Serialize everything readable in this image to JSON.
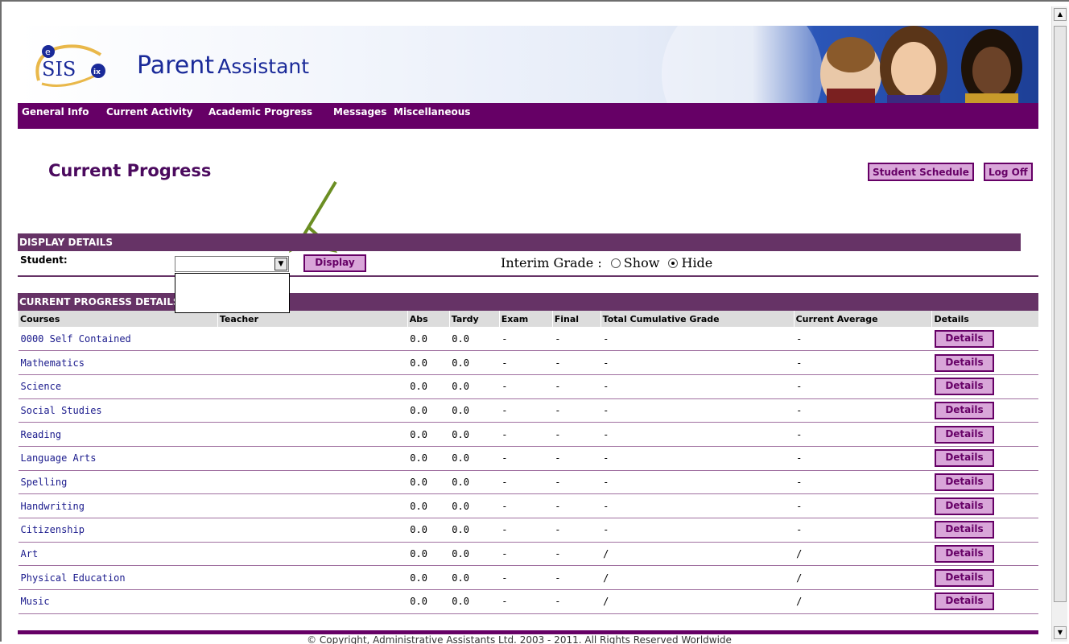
{
  "brand": {
    "logo_text": "SIS",
    "title_main": "Parent",
    "title_sub": "Assistant"
  },
  "nav": {
    "items": [
      "General Info",
      "Current Activity",
      "Academic Progress",
      "Messages",
      "Miscellaneous"
    ]
  },
  "page": {
    "title": "Current Progress",
    "student_schedule_label": "Student Schedule",
    "logoff_label": "Log Off"
  },
  "display_details": {
    "heading": "DISPLAY DETAILS",
    "student_label": "Student:",
    "student_value": "",
    "display_label": "Display",
    "interim_label": "Interim Grade :",
    "show_label": "Show",
    "hide_label": "Hide",
    "interim_selected": "Hide"
  },
  "progress": {
    "heading": "CURRENT PROGRESS DETAILS",
    "columns": [
      "Courses",
      "Teacher",
      "Abs",
      "Tardy",
      "Exam",
      "Final",
      "Total Cumulative Grade",
      "Current Average",
      "Details"
    ],
    "details_label": "Details",
    "rows": [
      {
        "course": "0000 Self Contained",
        "teacher": "",
        "abs": "0.0",
        "tardy": "0.0",
        "exam": "-",
        "final": "-",
        "total": "-",
        "avg": "-"
      },
      {
        "course": "Mathematics",
        "teacher": "",
        "abs": "0.0",
        "tardy": "0.0",
        "exam": "-",
        "final": "-",
        "total": "-",
        "avg": "-"
      },
      {
        "course": "Science",
        "teacher": "",
        "abs": "0.0",
        "tardy": "0.0",
        "exam": "-",
        "final": "-",
        "total": "-",
        "avg": "-"
      },
      {
        "course": "Social Studies",
        "teacher": "",
        "abs": "0.0",
        "tardy": "0.0",
        "exam": "-",
        "final": "-",
        "total": "-",
        "avg": "-"
      },
      {
        "course": "Reading",
        "teacher": "",
        "abs": "0.0",
        "tardy": "0.0",
        "exam": "-",
        "final": "-",
        "total": "-",
        "avg": "-"
      },
      {
        "course": "Language Arts",
        "teacher": "",
        "abs": "0.0",
        "tardy": "0.0",
        "exam": "-",
        "final": "-",
        "total": "-",
        "avg": "-"
      },
      {
        "course": "Spelling",
        "teacher": "",
        "abs": "0.0",
        "tardy": "0.0",
        "exam": "-",
        "final": "-",
        "total": "-",
        "avg": "-"
      },
      {
        "course": "Handwriting",
        "teacher": "",
        "abs": "0.0",
        "tardy": "0.0",
        "exam": "-",
        "final": "-",
        "total": "-",
        "avg": "-"
      },
      {
        "course": "Citizenship",
        "teacher": "",
        "abs": "0.0",
        "tardy": "0.0",
        "exam": "-",
        "final": "-",
        "total": "-",
        "avg": "-"
      },
      {
        "course": "Art",
        "teacher": "",
        "abs": "0.0",
        "tardy": "0.0",
        "exam": "-",
        "final": "-",
        "total": "/",
        "avg": "/"
      },
      {
        "course": "Physical Education",
        "teacher": "",
        "abs": "0.0",
        "tardy": "0.0",
        "exam": "-",
        "final": "-",
        "total": "/",
        "avg": "/"
      },
      {
        "course": "Music",
        "teacher": "",
        "abs": "0.0",
        "tardy": "0.0",
        "exam": "-",
        "final": "-",
        "total": "/",
        "avg": "/"
      }
    ]
  },
  "footer": {
    "text": "© Copyright, Administrative Assistants Ltd. 2003 - 2011. All Rights Reserved Worldwide"
  },
  "colors": {
    "nav_bg": "#660066",
    "section_bg": "#663366",
    "button_bg": "#d9a6d9",
    "title_color": "#4b0a5e",
    "arrow_color": "#6b8e23"
  },
  "icons": {
    "select_arrow": "chevron-down-icon",
    "scroll_up": "arrow-up-icon",
    "scroll_down": "arrow-down-icon"
  }
}
